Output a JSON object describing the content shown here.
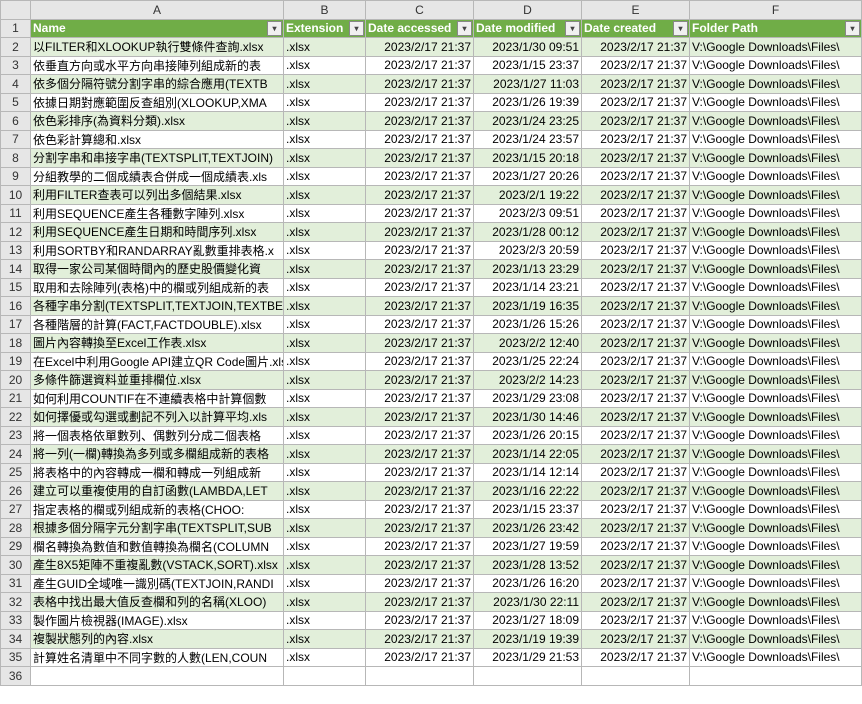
{
  "columns_letters": [
    "A",
    "B",
    "C",
    "D",
    "E",
    "F"
  ],
  "headers": [
    "Name",
    "Extension",
    "Date accessed",
    "Date modified",
    "Date created",
    "Folder Path"
  ],
  "rows": [
    {
      "n": "以FILTER和XLOOKUP執行雙條件查詢.xlsx",
      "e": ".xlsx",
      "a": "2023/2/17 21:37",
      "m": "2023/1/30 09:51",
      "c": "2023/2/17 21:37",
      "p": "V:\\Google Downloads\\Files\\"
    },
    {
      "n": "依垂直方向或水平方向串接陣列組成新的表",
      "e": ".xlsx",
      "a": "2023/2/17 21:37",
      "m": "2023/1/15 23:37",
      "c": "2023/2/17 21:37",
      "p": "V:\\Google Downloads\\Files\\"
    },
    {
      "n": "依多個分隔符號分割字串的綜合應用(TEXTB",
      "e": ".xlsx",
      "a": "2023/2/17 21:37",
      "m": "2023/1/27 11:03",
      "c": "2023/2/17 21:37",
      "p": "V:\\Google Downloads\\Files\\"
    },
    {
      "n": "依據日期對應範圍反查組別(XLOOKUP,XMA",
      "e": ".xlsx",
      "a": "2023/2/17 21:37",
      "m": "2023/1/26 19:39",
      "c": "2023/2/17 21:37",
      "p": "V:\\Google Downloads\\Files\\"
    },
    {
      "n": "依色彩排序(為資料分類).xlsx",
      "e": ".xlsx",
      "a": "2023/2/17 21:37",
      "m": "2023/1/24 23:25",
      "c": "2023/2/17 21:37",
      "p": "V:\\Google Downloads\\Files\\"
    },
    {
      "n": "依色彩計算總和.xlsx",
      "e": ".xlsx",
      "a": "2023/2/17 21:37",
      "m": "2023/1/24 23:57",
      "c": "2023/2/17 21:37",
      "p": "V:\\Google Downloads\\Files\\"
    },
    {
      "n": "分割字串和串接字串(TEXTSPLIT,TEXTJOIN)",
      "e": ".xlsx",
      "a": "2023/2/17 21:37",
      "m": "2023/1/15 20:18",
      "c": "2023/2/17 21:37",
      "p": "V:\\Google Downloads\\Files\\"
    },
    {
      "n": "分組教學的二個成績表合併成一個成績表.xls",
      "e": ".xlsx",
      "a": "2023/2/17 21:37",
      "m": "2023/1/27 20:26",
      "c": "2023/2/17 21:37",
      "p": "V:\\Google Downloads\\Files\\"
    },
    {
      "n": "利用FILTER查表可以列出多個結果.xlsx",
      "e": ".xlsx",
      "a": "2023/2/17 21:37",
      "m": "2023/2/1 19:22",
      "c": "2023/2/17 21:37",
      "p": "V:\\Google Downloads\\Files\\"
    },
    {
      "n": "利用SEQUENCE產生各種數字陣列.xlsx",
      "e": ".xlsx",
      "a": "2023/2/17 21:37",
      "m": "2023/2/3 09:51",
      "c": "2023/2/17 21:37",
      "p": "V:\\Google Downloads\\Files\\"
    },
    {
      "n": "利用SEQUENCE產生日期和時間序列.xlsx",
      "e": ".xlsx",
      "a": "2023/2/17 21:37",
      "m": "2023/1/28 00:12",
      "c": "2023/2/17 21:37",
      "p": "V:\\Google Downloads\\Files\\"
    },
    {
      "n": "利用SORTBY和RANDARRAY亂數重排表格.x",
      "e": ".xlsx",
      "a": "2023/2/17 21:37",
      "m": "2023/2/3 20:59",
      "c": "2023/2/17 21:37",
      "p": "V:\\Google Downloads\\Files\\"
    },
    {
      "n": "取得一家公司某個時間內的歷史股價變化資",
      "e": ".xlsx",
      "a": "2023/2/17 21:37",
      "m": "2023/1/13 23:29",
      "c": "2023/2/17 21:37",
      "p": "V:\\Google Downloads\\Files\\"
    },
    {
      "n": "取用和去除陣列(表格)中的欄或列組成新的表",
      "e": ".xlsx",
      "a": "2023/2/17 21:37",
      "m": "2023/1/14 23:21",
      "c": "2023/2/17 21:37",
      "p": "V:\\Google Downloads\\Files\\"
    },
    {
      "n": "各種字串分割(TEXTSPLIT,TEXTJOIN,TEXTBE",
      "e": ".xlsx",
      "a": "2023/2/17 21:37",
      "m": "2023/1/19 16:35",
      "c": "2023/2/17 21:37",
      "p": "V:\\Google Downloads\\Files\\"
    },
    {
      "n": "各種階層的計算(FACT,FACTDOUBLE).xlsx",
      "e": ".xlsx",
      "a": "2023/2/17 21:37",
      "m": "2023/1/26 15:26",
      "c": "2023/2/17 21:37",
      "p": "V:\\Google Downloads\\Files\\"
    },
    {
      "n": "圖片內容轉換至Excel工作表.xlsx",
      "e": ".xlsx",
      "a": "2023/2/17 21:37",
      "m": "2023/2/2 12:40",
      "c": "2023/2/17 21:37",
      "p": "V:\\Google Downloads\\Files\\"
    },
    {
      "n": "在Excel中利用Google API建立QR Code圖片.xls",
      "e": ".xlsx",
      "a": "2023/2/17 21:37",
      "m": "2023/1/25 22:24",
      "c": "2023/2/17 21:37",
      "p": "V:\\Google Downloads\\Files\\"
    },
    {
      "n": "多條件篩選資料並重排欄位.xlsx",
      "e": ".xlsx",
      "a": "2023/2/17 21:37",
      "m": "2023/2/2 14:23",
      "c": "2023/2/17 21:37",
      "p": "V:\\Google Downloads\\Files\\"
    },
    {
      "n": "如何利用COUNTIF在不連續表格中計算個數",
      "e": ".xlsx",
      "a": "2023/2/17 21:37",
      "m": "2023/1/29 23:08",
      "c": "2023/2/17 21:37",
      "p": "V:\\Google Downloads\\Files\\"
    },
    {
      "n": "如何擇優或勾選或劃記不列入以計算平均.xls",
      "e": ".xlsx",
      "a": "2023/2/17 21:37",
      "m": "2023/1/30 14:46",
      "c": "2023/2/17 21:37",
      "p": "V:\\Google Downloads\\Files\\"
    },
    {
      "n": "將一個表格依單數列、偶數列分成二個表格",
      "e": ".xlsx",
      "a": "2023/2/17 21:37",
      "m": "2023/1/26 20:15",
      "c": "2023/2/17 21:37",
      "p": "V:\\Google Downloads\\Files\\"
    },
    {
      "n": "將一列(一欄)轉換為多列或多欄組成新的表格",
      "e": ".xlsx",
      "a": "2023/2/17 21:37",
      "m": "2023/1/14 22:05",
      "c": "2023/2/17 21:37",
      "p": "V:\\Google Downloads\\Files\\"
    },
    {
      "n": "將表格中的內容轉成一欄和轉成一列組成新",
      "e": ".xlsx",
      "a": "2023/2/17 21:37",
      "m": "2023/1/14 12:14",
      "c": "2023/2/17 21:37",
      "p": "V:\\Google Downloads\\Files\\"
    },
    {
      "n": "建立可以重複使用的自訂函數(LAMBDA,LET",
      "e": ".xlsx",
      "a": "2023/2/17 21:37",
      "m": "2023/1/16 22:22",
      "c": "2023/2/17 21:37",
      "p": "V:\\Google Downloads\\Files\\"
    },
    {
      "n": "指定表格的欄或列組成新的表格(CHOO:",
      "e": ".xlsx",
      "a": "2023/2/17 21:37",
      "m": "2023/1/15 23:37",
      "c": "2023/2/17 21:37",
      "p": "V:\\Google Downloads\\Files\\"
    },
    {
      "n": "根據多個分隔字元分割字串(TEXTSPLIT,SUB",
      "e": ".xlsx",
      "a": "2023/2/17 21:37",
      "m": "2023/1/26 23:42",
      "c": "2023/2/17 21:37",
      "p": "V:\\Google Downloads\\Files\\"
    },
    {
      "n": "欄名轉換為數值和數值轉換為欄名(COLUMN",
      "e": ".xlsx",
      "a": "2023/2/17 21:37",
      "m": "2023/1/27 19:59",
      "c": "2023/2/17 21:37",
      "p": "V:\\Google Downloads\\Files\\"
    },
    {
      "n": "產生8X5矩陣不重複亂數(VSTACK,SORT).xlsx",
      "e": ".xlsx",
      "a": "2023/2/17 21:37",
      "m": "2023/1/28 13:52",
      "c": "2023/2/17 21:37",
      "p": "V:\\Google Downloads\\Files\\"
    },
    {
      "n": "產生GUID全域唯一識別碼(TEXTJOIN,RANDI",
      "e": ".xlsx",
      "a": "2023/2/17 21:37",
      "m": "2023/1/26 16:20",
      "c": "2023/2/17 21:37",
      "p": "V:\\Google Downloads\\Files\\"
    },
    {
      "n": "表格中找出最大值反查欄和列的名稱(XLOO)",
      "e": ".xlsx",
      "a": "2023/2/17 21:37",
      "m": "2023/1/30 22:11",
      "c": "2023/2/17 21:37",
      "p": "V:\\Google Downloads\\Files\\"
    },
    {
      "n": "製作圖片檢視器(IMAGE).xlsx",
      "e": ".xlsx",
      "a": "2023/2/17 21:37",
      "m": "2023/1/27 18:09",
      "c": "2023/2/17 21:37",
      "p": "V:\\Google Downloads\\Files\\"
    },
    {
      "n": "複製狀態列的內容.xlsx",
      "e": ".xlsx",
      "a": "2023/2/17 21:37",
      "m": "2023/1/19 19:39",
      "c": "2023/2/17 21:37",
      "p": "V:\\Google Downloads\\Files\\"
    },
    {
      "n": "計算姓名清單中不同字數的人數(LEN,COUN",
      "e": ".xlsx",
      "a": "2023/2/17 21:37",
      "m": "2023/1/29 21:53",
      "c": "2023/2/17 21:37",
      "p": "V:\\Google Downloads\\Files\\"
    }
  ],
  "last_row": 36
}
